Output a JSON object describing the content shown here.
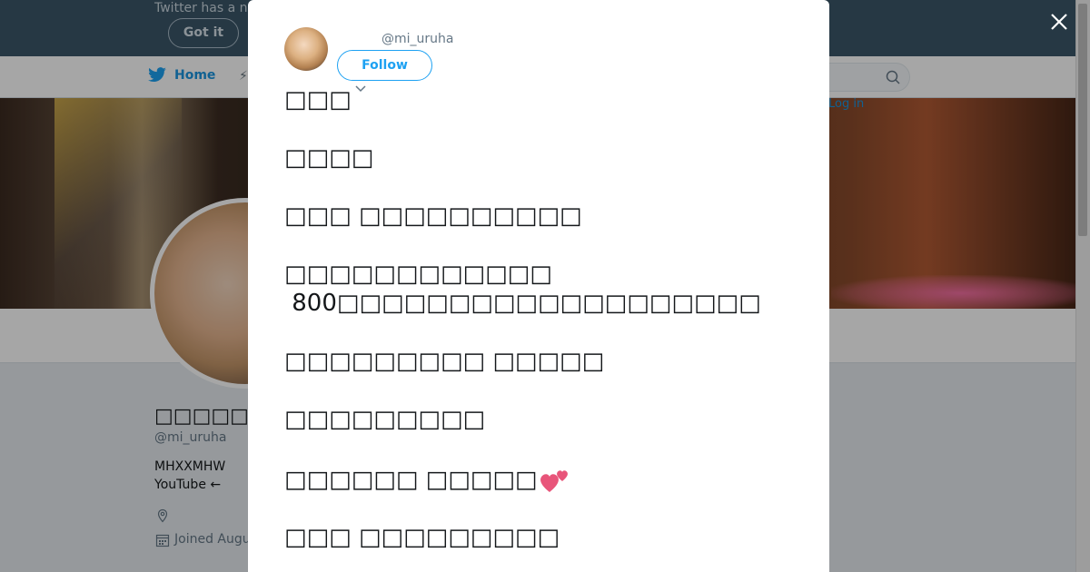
{
  "banner": {
    "text": "Twitter has a n",
    "got_it": "Got it"
  },
  "nav": {
    "home": "Home",
    "login": "Log in"
  },
  "profile": {
    "name": "□□□□□",
    "handle": "@mi_uruha",
    "bio_line1": "MHXXMHW",
    "bio_line2": "YouTube ←",
    "joined": "Joined Augu"
  },
  "modal": {
    "handle": "@mi_uruha",
    "follow_label": "Follow",
    "tweet_lines": [
      "□□□",
      "□□□□",
      "□□□ □□□□□□□□□□",
      "□□□□□□□□□□□□",
      " 800□□□□□□□□□□□□□□□□□□□",
      "□□□□□□□□□ □□□□□",
      "□□□□□□□□□",
      "□□□□□□ □□□□□",
      "□□□ □□□□□□□□□"
    ],
    "heart_emoji": "💕"
  },
  "colors": {
    "accent": "#1da1f2",
    "banner": "#3b5769",
    "heart": "#e8557a"
  }
}
